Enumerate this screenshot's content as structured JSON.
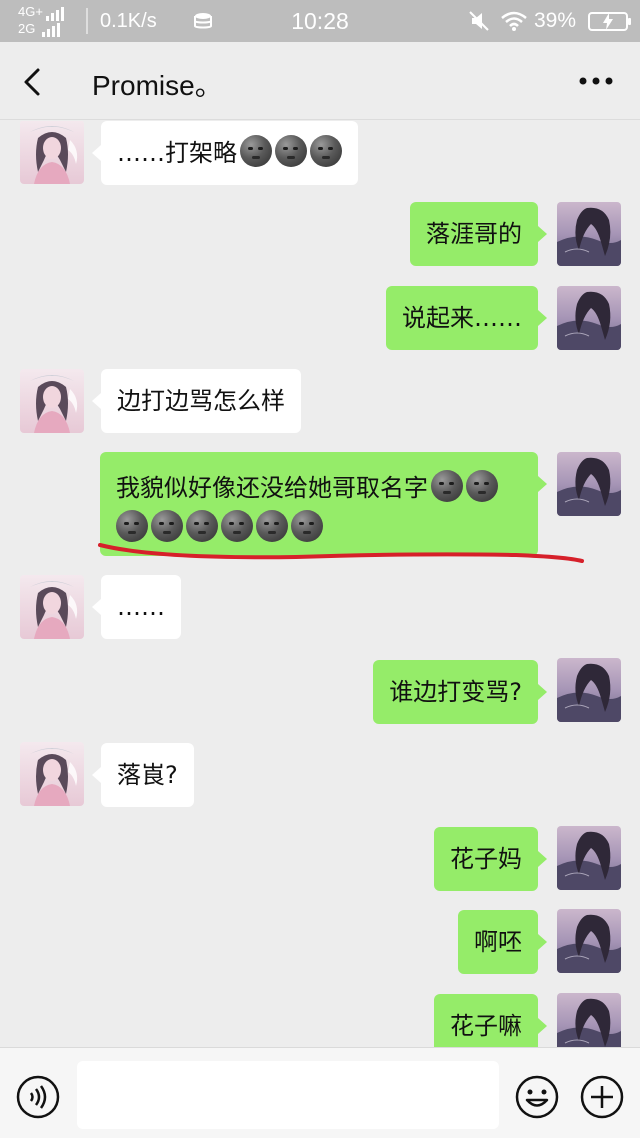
{
  "status_bar": {
    "network_top": "4G+",
    "network_bottom": "2G",
    "speed": "0.1K/s",
    "time": "10:28",
    "battery": "39%"
  },
  "nav": {
    "title": "Promise。",
    "back_icon": "chevron-left-icon",
    "more_icon": "more-dots-icon"
  },
  "messages": [
    {
      "side": "in",
      "text": "……打架略",
      "emojis": 3
    },
    {
      "side": "out",
      "text": "落涯哥的",
      "emojis": 0
    },
    {
      "side": "out",
      "text": "说起来……",
      "emojis": 0
    },
    {
      "side": "in",
      "text": "边打边骂怎么样",
      "emojis": 0
    },
    {
      "side": "out",
      "text": "我貌似好像还没给她哥取名字",
      "emojis": 8
    },
    {
      "side": "in",
      "text": "……",
      "emojis": 0
    },
    {
      "side": "out",
      "text": "谁边打变骂?",
      "emojis": 0
    },
    {
      "side": "in",
      "text": "落崀?",
      "emojis": 0
    },
    {
      "side": "out",
      "text": "花子妈",
      "emojis": 0
    },
    {
      "side": "out",
      "text": "啊呸",
      "emojis": 0
    },
    {
      "side": "out",
      "text": "花子嘛",
      "emojis": 0
    }
  ],
  "input_bar": {
    "voice_icon": "voice-icon",
    "emoji_icon": "emoji-icon",
    "plus_icon": "plus-icon",
    "placeholder": ""
  },
  "colors": {
    "outgoing_bubble": "#95ec69",
    "incoming_bubble": "#ffffff",
    "background": "#ededed",
    "annotation_underline": "#d6202a"
  }
}
